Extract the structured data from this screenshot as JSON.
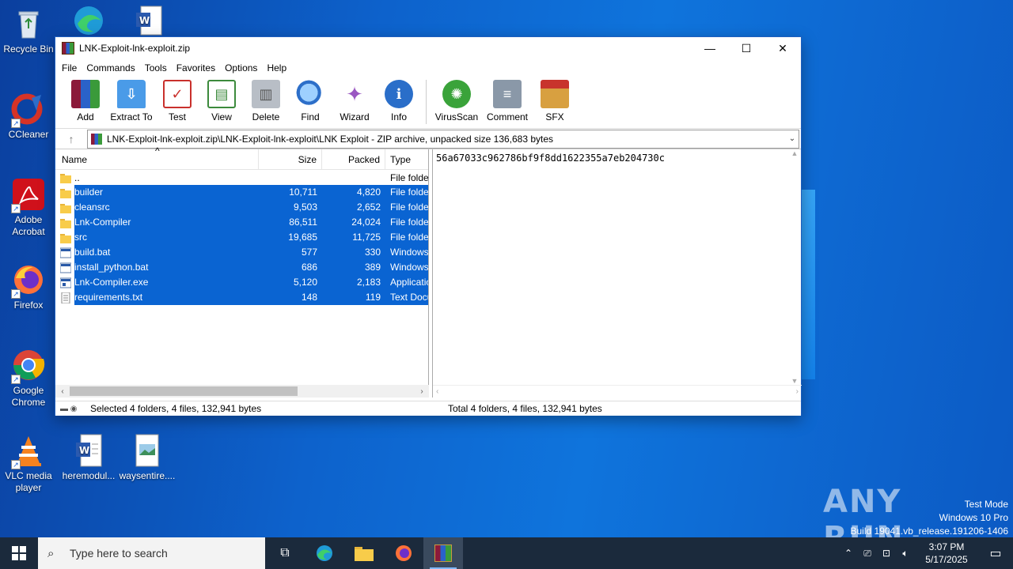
{
  "desktop": {
    "icons": [
      {
        "label": "Recycle Bin",
        "icon": "recycle-bin-icon"
      },
      {
        "label": "CCleaner",
        "icon": "ccleaner-icon"
      },
      {
        "label": "Adobe Acrobat",
        "icon": "acrobat-icon"
      },
      {
        "label": "Firefox",
        "icon": "firefox-icon"
      },
      {
        "label": "Google Chrome",
        "icon": "chrome-icon"
      },
      {
        "label": "VLC media player",
        "icon": "vlc-icon"
      },
      {
        "label": "heremodul...",
        "icon": "word-doc-icon"
      },
      {
        "label": "waysentire....",
        "icon": "image-file-icon"
      }
    ]
  },
  "window": {
    "title": "LNK-Exploit-lnk-exploit.zip",
    "menu": [
      "File",
      "Commands",
      "Tools",
      "Favorites",
      "Options",
      "Help"
    ],
    "toolbar": [
      {
        "label": "Add",
        "color": "#c8342c"
      },
      {
        "label": "Extract To",
        "color": "#2f7fd8"
      },
      {
        "label": "Test",
        "color": "#d33d2f"
      },
      {
        "label": "View",
        "color": "#3c8a3c"
      },
      {
        "label": "Delete",
        "color": "#8a8f96"
      },
      {
        "label": "Find",
        "color": "#2d6fc9"
      },
      {
        "label": "Wizard",
        "color": "#9a57c2"
      },
      {
        "label": "Info",
        "color": "#2a6ec9"
      },
      {
        "label": "VirusScan",
        "color": "#3aa33a"
      },
      {
        "label": "Comment",
        "color": "#8a98a8"
      },
      {
        "label": "SFX",
        "color": "#d8a040"
      }
    ],
    "address": "LNK-Exploit-lnk-exploit.zip\\LNK-Exploit-lnk-exploit\\LNK Exploit - ZIP archive, unpacked size 136,683 bytes",
    "columns": {
      "name": "Name",
      "size": "Size",
      "packed": "Packed",
      "type": "Type"
    },
    "rows": [
      {
        "name": "..",
        "size": "",
        "packed": "",
        "type": "File folder",
        "kind": "folder",
        "selected": false
      },
      {
        "name": "builder",
        "size": "10,711",
        "packed": "4,820",
        "type": "File folder",
        "kind": "folder",
        "selected": true
      },
      {
        "name": "cleansrc",
        "size": "9,503",
        "packed": "2,652",
        "type": "File folder",
        "kind": "folder",
        "selected": true
      },
      {
        "name": "Lnk-Compiler",
        "size": "86,511",
        "packed": "24,024",
        "type": "File folder",
        "kind": "folder",
        "selected": true
      },
      {
        "name": "src",
        "size": "19,685",
        "packed": "11,725",
        "type": "File folder",
        "kind": "folder",
        "selected": true
      },
      {
        "name": "build.bat",
        "size": "577",
        "packed": "330",
        "type": "Windows Batch File",
        "kind": "bat",
        "selected": true
      },
      {
        "name": "install_python.bat",
        "size": "686",
        "packed": "389",
        "type": "Windows Batch File",
        "kind": "bat",
        "selected": true
      },
      {
        "name": "Lnk-Compiler.exe",
        "size": "5,120",
        "packed": "2,183",
        "type": "Application",
        "kind": "exe",
        "selected": true
      },
      {
        "name": "requirements.txt",
        "size": "148",
        "packed": "119",
        "type": "Text Document",
        "kind": "txt",
        "selected": true
      }
    ],
    "comment": "56a67033c962786bf9f8dd1622355a7eb204730c",
    "status_left": "Selected 4 folders, 4 files, 132,941 bytes",
    "status_right": "Total 4 folders, 4 files, 132,941 bytes"
  },
  "taskbar": {
    "search_placeholder": "Type here to search",
    "time": "3:07 PM",
    "date": "5/17/2025"
  },
  "watermark": {
    "brand": "ANY RUN",
    "mode": "Test Mode",
    "edition": "Windows 10 Pro",
    "build": "Build 19041.vb_release.191206-1406"
  }
}
